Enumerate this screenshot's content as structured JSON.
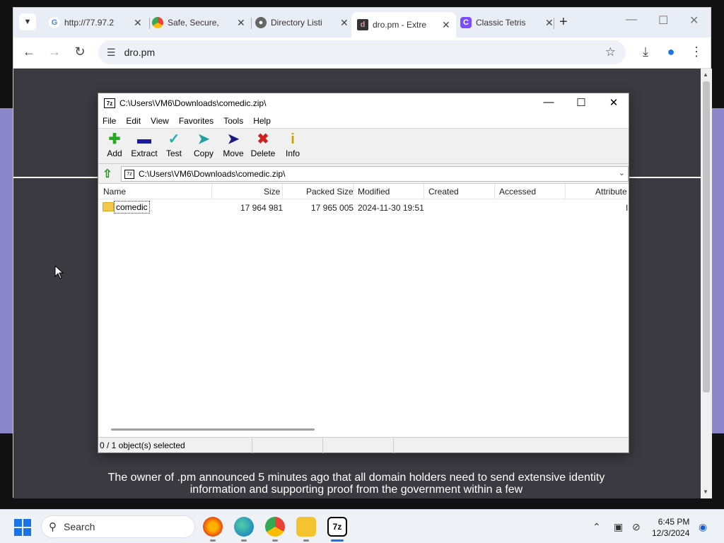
{
  "browser": {
    "tabs": [
      {
        "label": "http://77.97.2",
        "icon": "google-icon"
      },
      {
        "label": "Safe, Secure,",
        "icon": "chrome-icon"
      },
      {
        "label": "Directory Listi",
        "icon": "globe-icon"
      },
      {
        "label": "dro.pm - Extre",
        "icon": "dropm-icon",
        "active": true
      },
      {
        "label": "Classic Tetris",
        "icon": "tetris-icon"
      }
    ],
    "url": "dro.pm",
    "page_notice": "The owner of .pm announced 5 minutes ago that all domain holders need to send extensive identity information and supporting proof from the government within a few"
  },
  "sevenzip": {
    "title": "C:\\Users\\VM6\\Downloads\\comedic.zip\\",
    "menu": [
      "File",
      "Edit",
      "View",
      "Favorites",
      "Tools",
      "Help"
    ],
    "toolbar": [
      {
        "label": "Add",
        "icon": "plus-icon",
        "color": "#22aa22"
      },
      {
        "label": "Extract",
        "icon": "minus-icon",
        "color": "#1a1aa0"
      },
      {
        "label": "Test",
        "icon": "check-icon",
        "color": "#20b0b0"
      },
      {
        "label": "Copy",
        "icon": "copy-arrow-icon",
        "color": "#20a0a0"
      },
      {
        "label": "Move",
        "icon": "move-arrow-icon",
        "color": "#1a1a80"
      },
      {
        "label": "Delete",
        "icon": "delete-x-icon",
        "color": "#d02020"
      },
      {
        "label": "Info",
        "icon": "info-icon",
        "color": "#c8a000"
      }
    ],
    "address": "C:\\Users\\VM6\\Downloads\\comedic.zip\\",
    "columns": [
      "Name",
      "Size",
      "Packed Size",
      "Modified",
      "Created",
      "Accessed",
      "Attribute"
    ],
    "rows": [
      {
        "name": "comedic",
        "size": "17 964 981",
        "packed": "17 965 005",
        "modified": "2024-11-30 19:51",
        "created": "",
        "accessed": "",
        "attr": "I"
      }
    ],
    "status": "0 / 1 object(s) selected"
  },
  "taskbar": {
    "search_placeholder": "Search",
    "time": "6:45 PM",
    "date": "12/3/2024",
    "apps": [
      "firefox-icon",
      "edge-icon",
      "chrome-icon",
      "file-explorer-icon",
      "7zip-icon"
    ]
  }
}
